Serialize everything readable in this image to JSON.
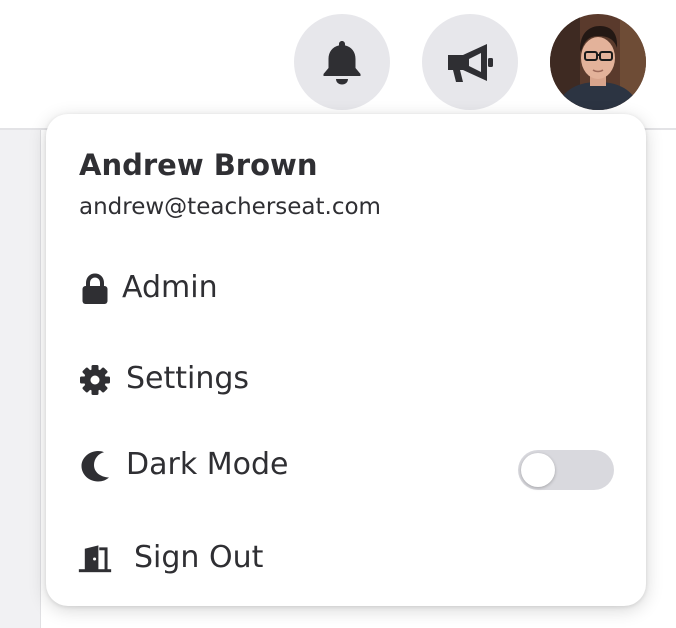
{
  "header": {
    "buttons": [
      {
        "name": "notifications",
        "icon": "bell-icon"
      },
      {
        "name": "announcements",
        "icon": "megaphone-icon"
      },
      {
        "name": "profile",
        "icon": "avatar"
      }
    ]
  },
  "user_menu": {
    "user": {
      "name": "Andrew Brown",
      "email": "andrew@teacherseat.com"
    },
    "items": [
      {
        "label": "Admin",
        "icon": "lock-icon"
      },
      {
        "label": "Settings",
        "icon": "gear-icon"
      },
      {
        "label": "Dark Mode",
        "icon": "moon-icon",
        "toggle": false
      },
      {
        "label": "Sign Out",
        "icon": "door-exit-icon"
      }
    ]
  },
  "colors": {
    "text": "#2f2f33",
    "icon": "#2f2f33",
    "icon_button_bg": "#e7e7eb",
    "toggle_off": "#d9d9de",
    "page_bg": "#f1f1f3",
    "surface": "#ffffff"
  }
}
